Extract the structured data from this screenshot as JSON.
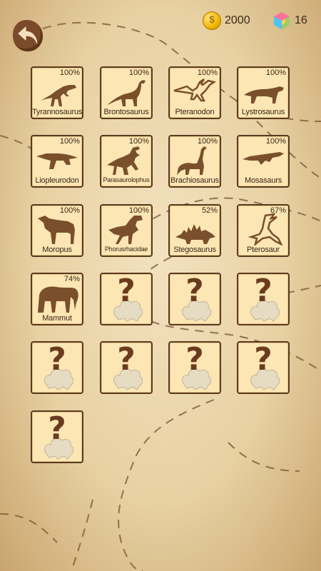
{
  "hud": {
    "coins": "2000",
    "gems": "16",
    "coin_icon": "coin-icon",
    "gem_icon": "gem-cube-icon"
  },
  "back_icon": "back-arrow-icon",
  "tiles": [
    {
      "name": "Tyrannosaurus",
      "percent": "100%",
      "silhouette": "tyrannosaurus-icon",
      "locked": false
    },
    {
      "name": "Brontosaurus",
      "percent": "100%",
      "silhouette": "brontosaurus-icon",
      "locked": false
    },
    {
      "name": "Pteranodon",
      "percent": "100%",
      "silhouette": "pteranodon-icon",
      "locked": false
    },
    {
      "name": "Lystrosaurus",
      "percent": "100%",
      "silhouette": "lystrosaurus-icon",
      "locked": false
    },
    {
      "name": "Liopleurodon",
      "percent": "100%",
      "silhouette": "liopleurodon-icon",
      "locked": false
    },
    {
      "name": "Parasaurolophus",
      "percent": "100%",
      "silhouette": "parasaurolophus-icon",
      "locked": false
    },
    {
      "name": "Brachiosaurus",
      "percent": "100%",
      "silhouette": "brachiosaurus-icon",
      "locked": false
    },
    {
      "name": "Mosasaurs",
      "percent": "100%",
      "silhouette": "mosasaurus-icon",
      "locked": false
    },
    {
      "name": "Moropus",
      "percent": "100%",
      "silhouette": "moropus-icon",
      "locked": false
    },
    {
      "name": "Phorusrhacidae",
      "percent": "100%",
      "silhouette": "phorusrhacidae-icon",
      "locked": false
    },
    {
      "name": "Stegosaurus",
      "percent": "52%",
      "silhouette": "stegosaurus-icon",
      "locked": false
    },
    {
      "name": "Pterosaur",
      "percent": "67%",
      "silhouette": "pterosaur-icon",
      "locked": false
    },
    {
      "name": "Mammut",
      "percent": "74%",
      "silhouette": "mammoth-icon",
      "locked": false
    },
    {
      "name": "?",
      "locked": true
    },
    {
      "name": "?",
      "locked": true
    },
    {
      "name": "?",
      "locked": true
    },
    {
      "name": "?",
      "locked": true
    },
    {
      "name": "?",
      "locked": true
    },
    {
      "name": "?",
      "locked": true
    },
    {
      "name": "?",
      "locked": true
    },
    {
      "name": "?",
      "locked": true
    }
  ],
  "colors": {
    "tile_bg": "#fbe6b4",
    "tile_border": "#5a3a1f",
    "silhouette": "#7a4f2c",
    "locked_ghost": "#e6dcc3"
  }
}
